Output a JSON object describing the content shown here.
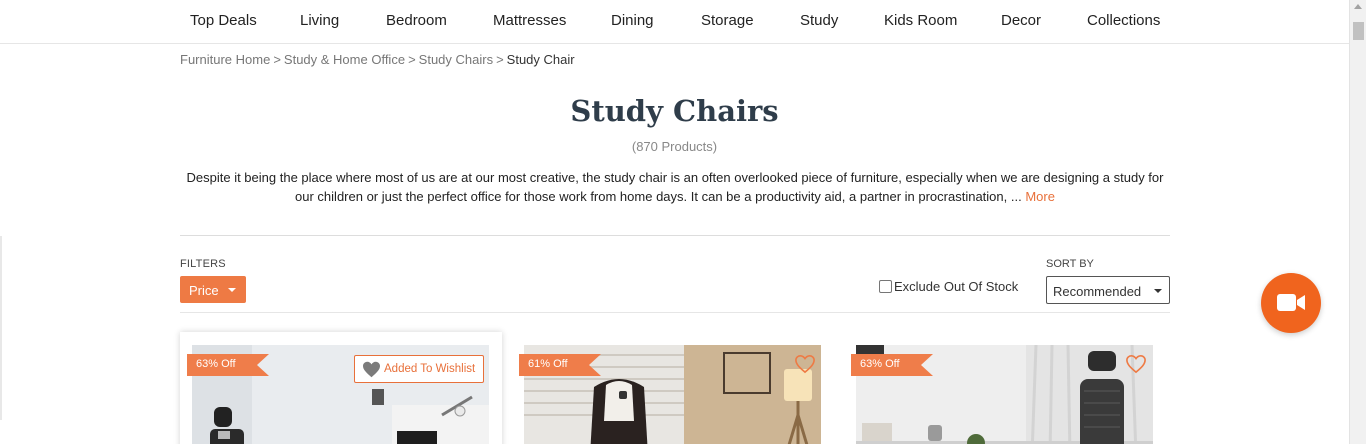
{
  "nav": {
    "items": [
      "Top Deals",
      "Living",
      "Bedroom",
      "Mattresses",
      "Dining",
      "Storage",
      "Study",
      "Kids Room",
      "Decor",
      "Collections"
    ]
  },
  "breadcrumb": {
    "items": [
      "Furniture Home",
      "Study & Home Office",
      "Study Chairs"
    ],
    "separator": ">",
    "current": "Study Chair"
  },
  "page": {
    "title": "Study Chairs",
    "count": "(870 Products)",
    "description": "Despite it being the place where most of us are at our most creative, the study chair is an often overlooked piece of furniture, especially when we are designing a study for our children or just the perfect office for those work from home days. It can be a productivity aid, a partner in procrastination, ...",
    "more_label": "More"
  },
  "filters": {
    "label": "FILTERS",
    "price_label": "Price",
    "exclude_label": "Exclude Out Of Stock",
    "exclude_checked": false,
    "sort_label": "SORT BY",
    "sort_value": "Recommended"
  },
  "products": [
    {
      "discount": "63% Off",
      "wishlist_label": "Added To Wishlist",
      "wishlisted": true
    },
    {
      "discount": "61% Off",
      "wishlisted": false
    },
    {
      "discount": "63% Off",
      "wishlisted": false
    }
  ],
  "icons": {
    "video": "video-camera-icon",
    "heart": "heart-outline-icon",
    "wishlist": "heart-filled-icon"
  },
  "colors": {
    "accent": "#ee7a44",
    "video_button": "#f0641e",
    "title": "#2f3d4a"
  }
}
